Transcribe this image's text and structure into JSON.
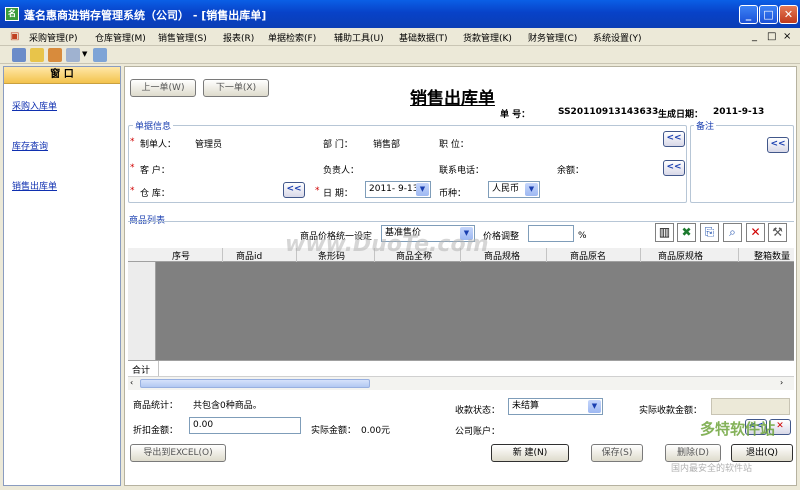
{
  "window": {
    "title": "蓬名惠商进销存管理系统（公司） - [销售出库单]",
    "app_icon": "app-icon",
    "buttons": [
      "_",
      "□",
      "✕"
    ]
  },
  "menu": {
    "items": [
      "采购管理(P)",
      "仓库管理(M)",
      "销售管理(S)",
      "报表(R)",
      "单据检索(F)",
      "辅助工具(U)",
      "基础数据(T)",
      "货款管理(K)",
      "财务管理(C)",
      "系统设置(Y)"
    ],
    "mdi_controls": [
      "_",
      "□",
      "×"
    ]
  },
  "toolbar": {
    "icons": [
      "org-icon",
      "open-folder-icon",
      "people-icon",
      "document-icon",
      "dropdown-icon",
      "grid-icon"
    ]
  },
  "left_panel": {
    "header": "窗      口",
    "links": [
      "采购入库单",
      "库存查询",
      "销售出库单"
    ]
  },
  "main": {
    "prev_button": "上一单(W)",
    "next_button": "下一单(X)",
    "doc_title": "销售出库单",
    "doc_no_label": "单    号：",
    "doc_no": "SS20110913143633",
    "gen_date_label": "生成日期：",
    "gen_date": "2011-9-13",
    "bill_info_label": "单据信息",
    "remark_label": "备注",
    "maker_label": "制单人：",
    "maker_value": "管理员",
    "dept_label": "部  门：",
    "dept_value": "销售部",
    "position_label": "职  位：",
    "customer_label": "客  户：",
    "principal_label": "负责人：",
    "phone_label": "联系电话：",
    "balance_label": "余额：",
    "warehouse_label": "仓  库：",
    "date_label": "日  期：",
    "date_value": "2011- 9-13",
    "currency_label": "币种：",
    "currency_value": "人民币",
    "collapse_btn": "<<",
    "product_list_label": "商品列表",
    "price_unified_label": "商品价格统一设定",
    "price_unified_value": "基准售价",
    "price_adjust_label": "价格调整",
    "percent": "%",
    "columns": [
      "序号",
      "商品id",
      "条形码",
      "商品全称",
      "商品规格",
      "商品原名",
      "商品原规格",
      "整箱数量"
    ],
    "total_label": "合计",
    "product_stats_label": "商品统计：",
    "product_stats_value": "共包含0种商品。",
    "receipt_status_label": "收款状态：",
    "receipt_status_value": "未结算",
    "actual_receipt_label": "实际收款金额：",
    "discount_label": "折扣金额：",
    "discount_value": "0.00",
    "actual_amount_label": "实际金额：",
    "actual_amount_value": "0.00元",
    "company_account_label": "公司账户：",
    "export_button": "导出到EXCEL(O)",
    "new_button": "新  建(N)",
    "save_button": "保存(S)",
    "delete_button": "删除(D)",
    "exit_button": "退出(Q)"
  },
  "watermark": {
    "center": "www.DuoTe.com",
    "corner_title": "多特软件站",
    "corner_sub": "国内最安全的软件站"
  }
}
